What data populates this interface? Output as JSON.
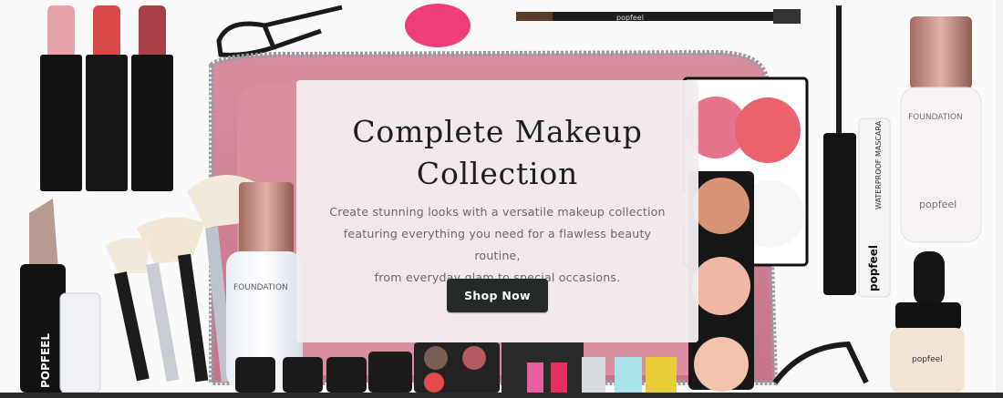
{
  "hero": {
    "title_line1": "Complete Makeup",
    "title_line2": "Collection",
    "description_line1": "Create stunning looks with a versatile makeup collection",
    "description_line2": "featuring everything you need for a flawless beauty routine,",
    "description_line3": "from everyday glam to special occasions.",
    "cta_label": "Shop Now"
  },
  "product_labels": {
    "brow_pencil_brand": "popfeel",
    "vertical_brand": "POPFEEL",
    "foundation_label": "FOUNDATION",
    "foundation_brand": "popfeel",
    "mascara_label": "WATERPROOF MASCARA",
    "mascara_brand": "popfeel",
    "foundation_label_2": "FOUNDATION",
    "dropper_brand": "popfeel"
  },
  "colors": {
    "card_background": "#f2ecf0",
    "button_background": "#242b27",
    "button_text": "#ffffff",
    "title_color": "#1f1c22",
    "body_text": "#6a666b"
  }
}
